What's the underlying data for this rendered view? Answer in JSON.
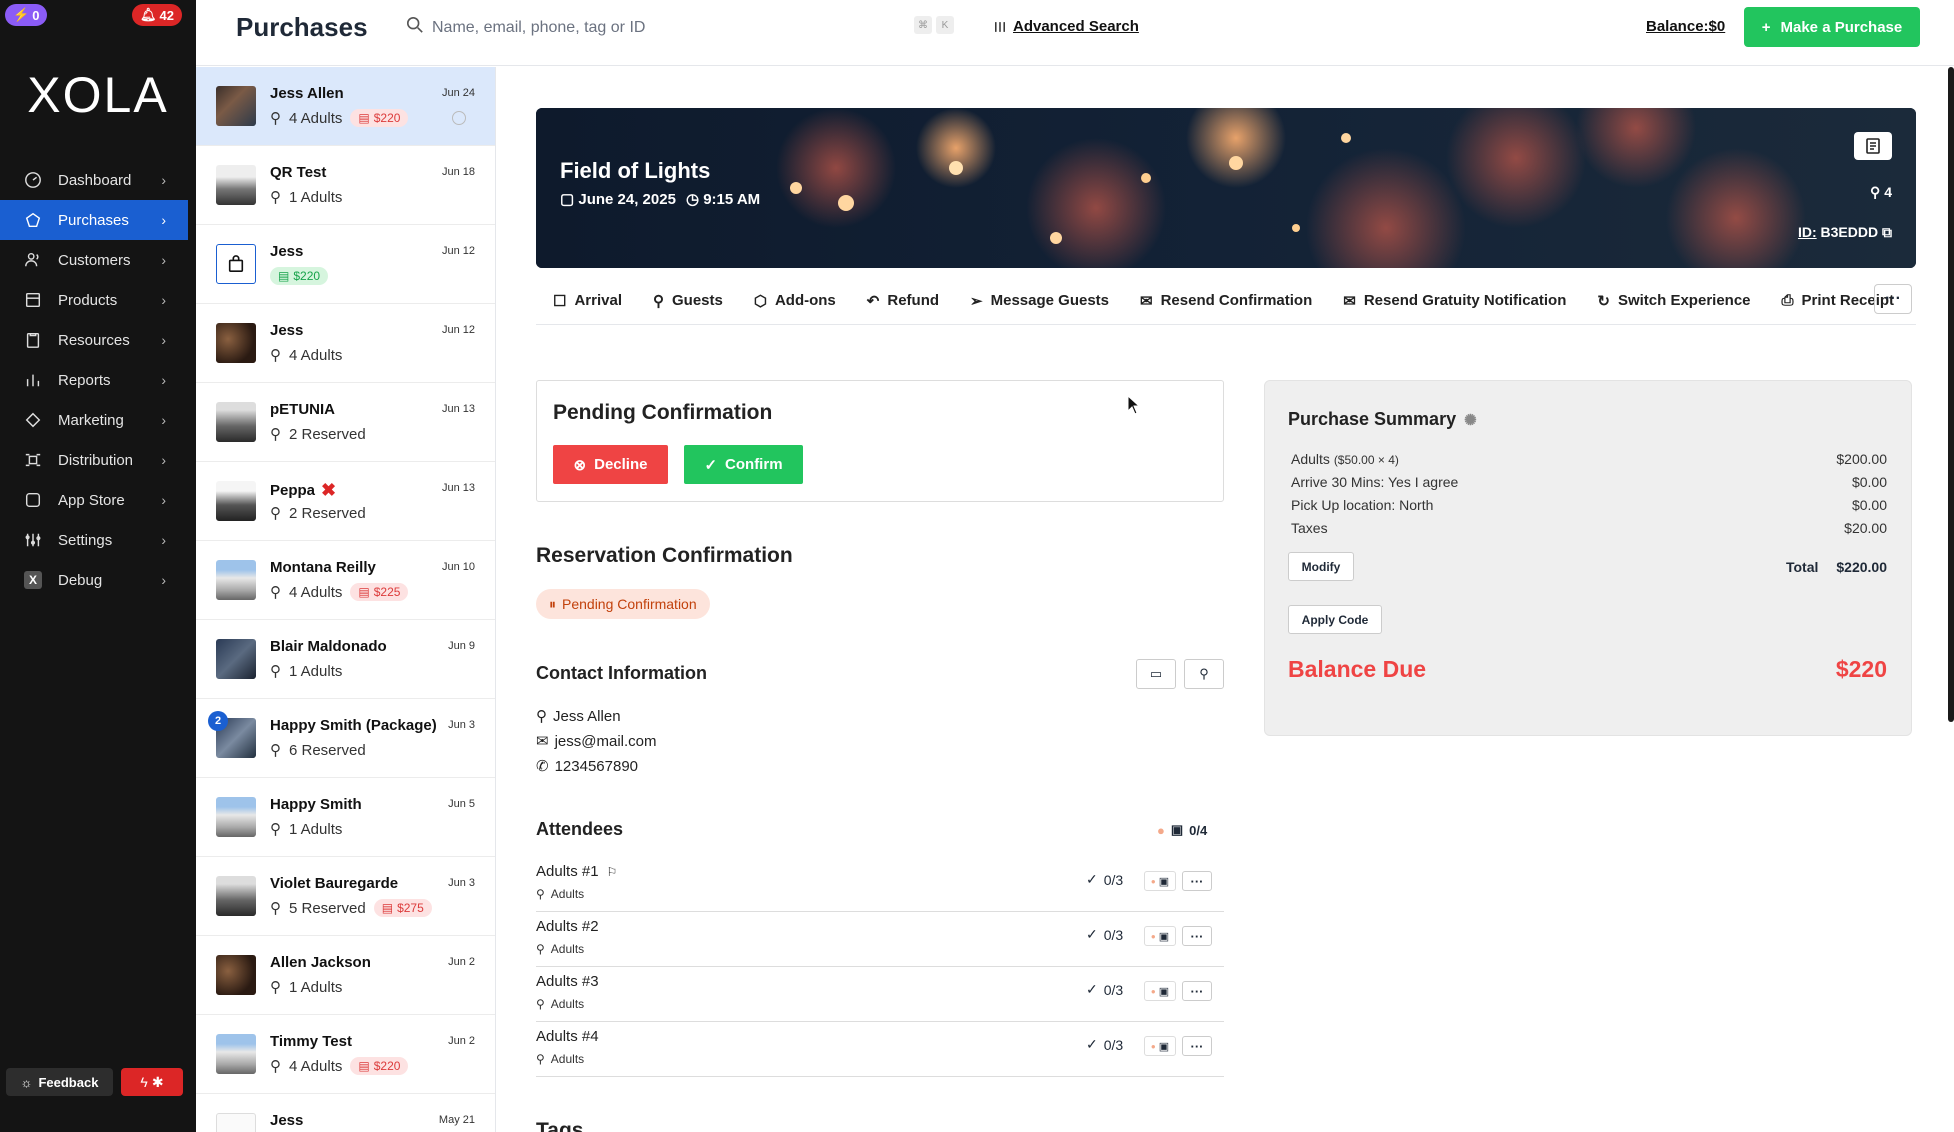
{
  "badges": {
    "left": "0",
    "right": "42"
  },
  "sidebar": {
    "logo": "XOLA",
    "items": [
      {
        "label": "Dashboard",
        "icon": "dashboard-icon"
      },
      {
        "label": "Purchases",
        "icon": "purchases-icon"
      },
      {
        "label": "Customers",
        "icon": "customers-icon"
      },
      {
        "label": "Products",
        "icon": "products-icon"
      },
      {
        "label": "Resources",
        "icon": "resources-icon"
      },
      {
        "label": "Reports",
        "icon": "reports-icon"
      },
      {
        "label": "Marketing",
        "icon": "marketing-icon"
      },
      {
        "label": "Distribution",
        "icon": "distribution-icon"
      },
      {
        "label": "App Store",
        "icon": "app-store-icon"
      },
      {
        "label": "Settings",
        "icon": "settings-icon"
      },
      {
        "label": "Debug",
        "icon": "debug-icon"
      }
    ],
    "feedback_label": "Feedback"
  },
  "header": {
    "title": "Purchases",
    "search_placeholder": "Name, email, phone, tag or ID",
    "kbd1": "⌘",
    "kbd2": "K",
    "advanced_search": "Advanced Search",
    "balance": "Balance:$0",
    "make_purchase": "Make a Purchase"
  },
  "purchases": [
    {
      "name": "Jess Allen",
      "date": "Jun 24",
      "sub": "4 Adults",
      "pill": "$220"
    },
    {
      "name": "QR Test",
      "date": "Jun 18",
      "sub": "1 Adults"
    },
    {
      "name": "Jess",
      "date": "Jun 12",
      "pill_green": "$220"
    },
    {
      "name": "Jess",
      "date": "Jun 12",
      "sub": "4 Adults"
    },
    {
      "name": "pETUNIA",
      "date": "Jun 13",
      "sub": "2 Reserved"
    },
    {
      "name": "Peppa",
      "date": "Jun 13",
      "sub": "2 Reserved"
    },
    {
      "name": "Montana Reilly",
      "date": "Jun 10",
      "sub": "4 Adults",
      "pill": "$225"
    },
    {
      "name": "Blair Maldonado",
      "date": "Jun 9",
      "sub": "1 Adults"
    },
    {
      "name": "Happy Smith (Package)",
      "date": "Jun 3",
      "sub": "6 Reserved",
      "badge": "2"
    },
    {
      "name": "Happy Smith",
      "date": "Jun 5",
      "sub": "1 Adults"
    },
    {
      "name": "Violet Bauregarde",
      "date": "Jun 3",
      "sub": "5 Reserved",
      "pill": "$275"
    },
    {
      "name": "Allen Jackson",
      "date": "Jun 2",
      "sub": "1 Adults"
    },
    {
      "name": "Timmy Test",
      "date": "Jun 2",
      "sub": "4 Adults",
      "pill": "$220"
    },
    {
      "name": "Jess",
      "date": "May 21"
    }
  ],
  "hero": {
    "title": "Field of Lights",
    "date": "June 24, 2025",
    "time": "9:15 AM",
    "count": "4",
    "id_label": "ID:",
    "id_value": "B3EDDD"
  },
  "actions": [
    "Arrival",
    "Guests",
    "Add-ons",
    "Refund",
    "Message Guests",
    "Resend Confirmation",
    "Resend Gratuity Notification",
    "Switch Experience",
    "Print Receipt"
  ],
  "pending": {
    "title": "Pending Confirmation",
    "decline": "Decline",
    "confirm": "Confirm"
  },
  "reservation": {
    "title": "Reservation Confirmation",
    "status": "Pending Confirmation"
  },
  "contact": {
    "title": "Contact Information",
    "name": "Jess Allen",
    "email": "jess@mail.com",
    "phone": "1234567890"
  },
  "attendees": {
    "title": "Attendees",
    "count": "0/4",
    "rows": [
      {
        "name": "Adults #1",
        "type": "Adults",
        "check": "0/3"
      },
      {
        "name": "Adults #2",
        "type": "Adults",
        "check": "0/3"
      },
      {
        "name": "Adults #3",
        "type": "Adults",
        "check": "0/3"
      },
      {
        "name": "Adults #4",
        "type": "Adults",
        "check": "0/3"
      }
    ]
  },
  "tags_title": "Tags",
  "summary": {
    "title": "Purchase Summary",
    "lines": [
      {
        "label": "Adults",
        "detail": "($50.00 × 4)",
        "amount": "$200.00"
      },
      {
        "label": "Arrive 30 Mins: Yes I agree",
        "amount": "$0.00"
      },
      {
        "label": "Pick Up location: North",
        "amount": "$0.00"
      },
      {
        "label": "Taxes",
        "amount": "$20.00"
      }
    ],
    "modify": "Modify",
    "total_label": "Total",
    "total_value": "$220.00",
    "apply_code": "Apply Code",
    "balance_due_label": "Balance Due",
    "balance_due_value": "$220"
  },
  "colors": {
    "accent": "#1a5fd1",
    "success": "#22c55e",
    "danger": "#ef4444",
    "sidebar_bg": "#141414"
  }
}
